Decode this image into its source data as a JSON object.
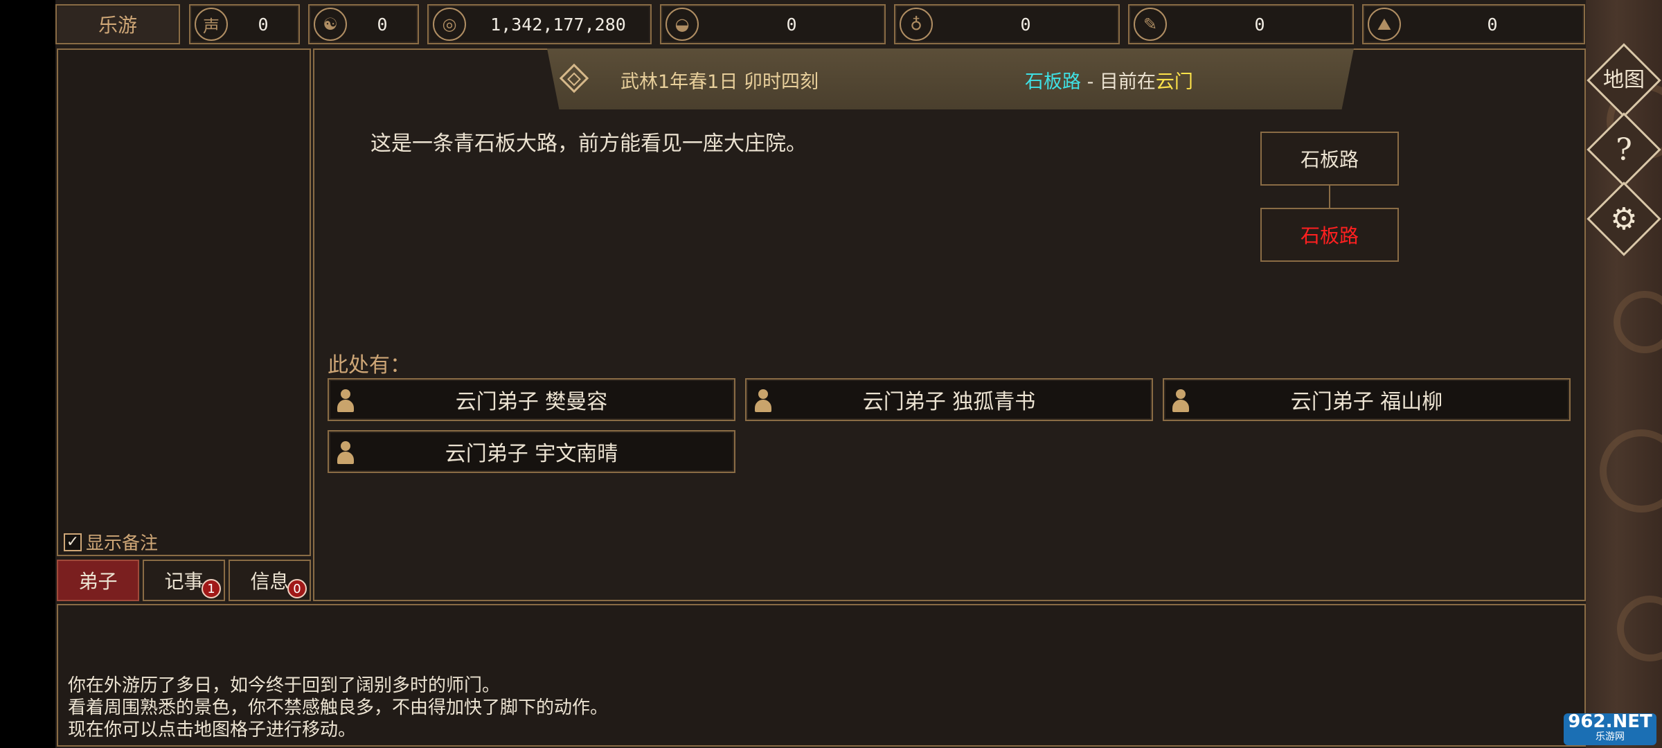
{
  "topbar": {
    "account": "乐游",
    "resources": [
      {
        "icon": "reputation-icon",
        "glyph": "声",
        "value": "0"
      },
      {
        "icon": "yin-yang-icon",
        "glyph": "☯",
        "value": "0"
      },
      {
        "icon": "coin-icon",
        "glyph": "◎",
        "value": "1,342,177,280"
      },
      {
        "icon": "food-bowl-icon",
        "glyph": "◒",
        "value": "0"
      },
      {
        "icon": "gourd-icon",
        "glyph": "♁",
        "value": "0"
      },
      {
        "icon": "scroll-icon",
        "glyph": "✎",
        "value": "0"
      },
      {
        "icon": "ore-icon",
        "glyph": "⛰",
        "value": "0"
      }
    ]
  },
  "banner": {
    "date": "武林1年春1日 卯时四刻",
    "location": "石板路",
    "separator": " - 目前在",
    "sect": "云门"
  },
  "description": "这是一条青石板大路，前方能看见一座大庄院。",
  "mini_map": {
    "top_node": "石板路",
    "current_node": "石板路"
  },
  "here": {
    "label": "此处有：",
    "npcs": [
      "云门弟子  樊曼容",
      "云门弟子  独孤青书",
      "云门弟子  福山柳",
      "云门弟子  宇文南晴"
    ]
  },
  "left_panel": {
    "show_notes_label": "显示备注",
    "show_notes_checked": true
  },
  "tabs": [
    {
      "label": "弟子",
      "badge": ""
    },
    {
      "label": "记事",
      "badge": "1"
    },
    {
      "label": "信息",
      "badge": "0"
    }
  ],
  "side_buttons": {
    "map": "地图",
    "help": "?",
    "settings": "⚙"
  },
  "log": [
    "你在外游历了多日，如今终于回到了阔别多时的师门。",
    "看着周围熟悉的景色，你不禁感触良多，不由得加快了脚下的动作。",
    "现在你可以点击地图格子进行移动。"
  ],
  "watermark": {
    "line1": "962.NET",
    "line2": "乐游网"
  },
  "colors": {
    "border_gold": "#8a6c45",
    "location_cyan": "#3fe0e4",
    "sect_yellow": "#ffe34a",
    "current_node_red": "#ff2020",
    "active_tab": "#7a1f1f"
  }
}
